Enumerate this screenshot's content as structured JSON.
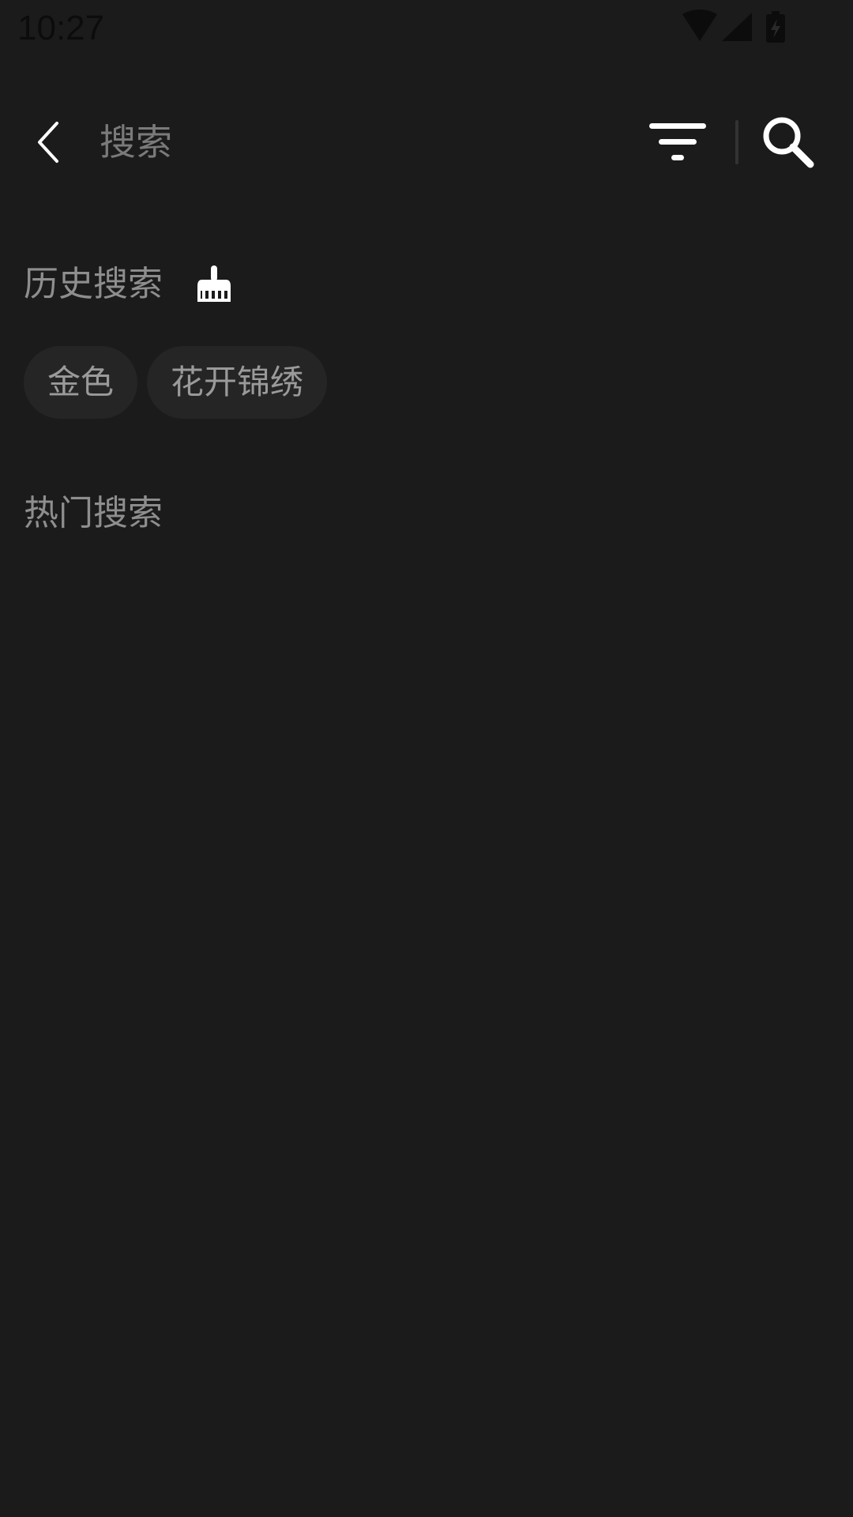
{
  "status_bar": {
    "time": "10:27",
    "icons": [
      "wifi-icon",
      "signal-icon",
      "battery-charging-icon"
    ]
  },
  "topbar": {
    "back_icon": "chevron-left-icon",
    "search_placeholder": "搜索",
    "search_value": "",
    "filter_icon": "filter-icon",
    "search_icon": "search-icon"
  },
  "history": {
    "title": "历史搜索",
    "clear_icon": "broom-icon",
    "items": [
      {
        "label": "金色"
      },
      {
        "label": "花开锦绣"
      }
    ]
  },
  "hot": {
    "title": "热门搜索",
    "items": []
  },
  "colors": {
    "background": "#1b1b1b",
    "chip_background": "#252525",
    "section_text": "#8e8e8e",
    "placeholder_text": "#7a7a7a",
    "icon_white": "#ffffff"
  }
}
